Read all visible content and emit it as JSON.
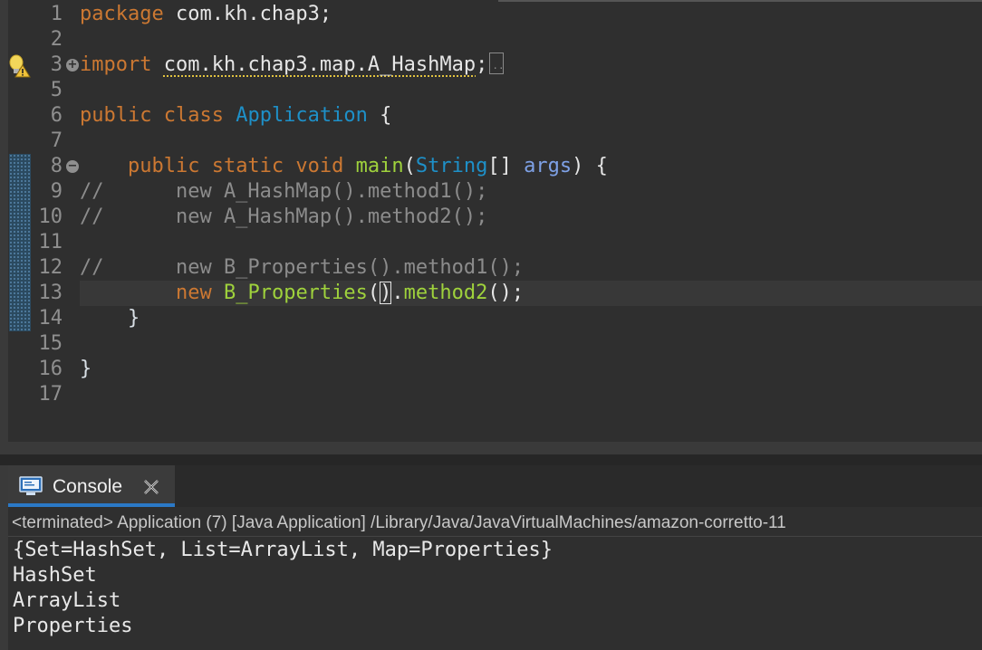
{
  "editor": {
    "line_numbers": [
      "1",
      "2",
      "3",
      "5",
      "6",
      "7",
      "8",
      "9",
      "10",
      "11",
      "12",
      "13",
      "14",
      "15",
      "16",
      "17"
    ],
    "lines": {
      "l1_kw": "package",
      "l1_rest": " com.kh.chap3;",
      "l3_kw": "import",
      "l3_pkg": "com.kh.chap3.map.A_HashMap",
      "l3_semi": ";",
      "l6_kw": "public class",
      "l6_cls": "Application",
      "l6_brace": " {",
      "l8_indent": "    ",
      "l8_kw": "public static void",
      "l8_fn": "main",
      "l8_open": "(",
      "l8_type": "String",
      "l8_arr": "[] ",
      "l8_param": "args",
      "l8_close": ") {",
      "l9": "//      new A_HashMap().method1();",
      "l10": "//      new A_HashMap().method2();",
      "l12": "//      new B_Properties().method1();",
      "l13_indent": "        ",
      "l13_kw": "new",
      "l13_cls": "B_Properties",
      "l13_open": "(",
      "l13_close": ")",
      "l13_rest": ".method2();",
      "l13_fn": "method2",
      "l14": "    }",
      "l16": "}"
    }
  },
  "console": {
    "tab_label": "Console",
    "status": "<terminated> Application (7) [Java Application] /Library/Java/JavaVirtualMachines/amazon-corretto-11",
    "output": [
      "{Set=HashSet, List=ArrayList, Map=Properties}",
      "HashSet",
      "ArrayList",
      "Properties"
    ]
  },
  "icons": {
    "fold_collapsed": "plus-fold-icon",
    "fold_expanded": "minus-fold-icon",
    "quickfix": "lightbulb-warning-icon",
    "console_tab": "console-monitor-icon",
    "close": "close-icon"
  },
  "colors": {
    "background": "#2f2f2f",
    "keyword": "#cc7832",
    "type": "#1e90c8",
    "method": "#9fd23c",
    "comment": "#8c8c8c",
    "tab_accent": "#2b79c7"
  }
}
